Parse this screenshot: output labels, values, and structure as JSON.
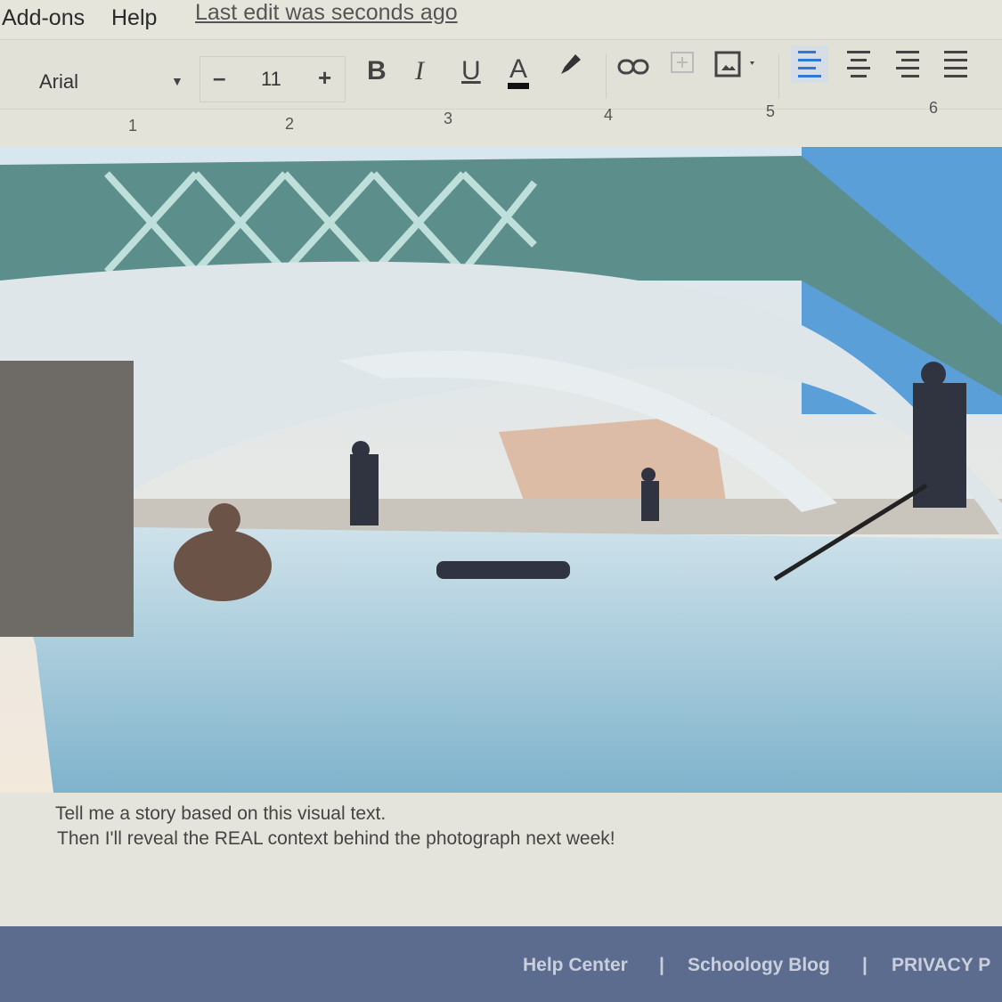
{
  "menubar": {
    "items": [
      "Add-ons",
      "Help"
    ],
    "last_edit": "Last edit was seconds ago"
  },
  "toolbar": {
    "font": "Arial",
    "font_size": "11",
    "minus": "–",
    "plus": "+",
    "bold": "B",
    "italic": "I",
    "underline": "U",
    "text_color": "A",
    "text_color_hex": "#111111",
    "icons": [
      "highlighter-icon",
      "link-icon",
      "comment-icon",
      "image-icon",
      "align-left-icon",
      "align-center-icon",
      "align-right-icon",
      "align-justify-icon"
    ]
  },
  "ruler": {
    "numbers": [
      "1",
      "2",
      "3",
      "4",
      "5",
      "6"
    ]
  },
  "document": {
    "caption_lines": [
      "Tell me a story based on this visual text.",
      "Then I'll reveal the REAL context behind the photograph next week!"
    ]
  },
  "footer": {
    "links": [
      "Help Center",
      "Schoology Blog",
      "PRIVACY P"
    ],
    "separator": "|"
  }
}
